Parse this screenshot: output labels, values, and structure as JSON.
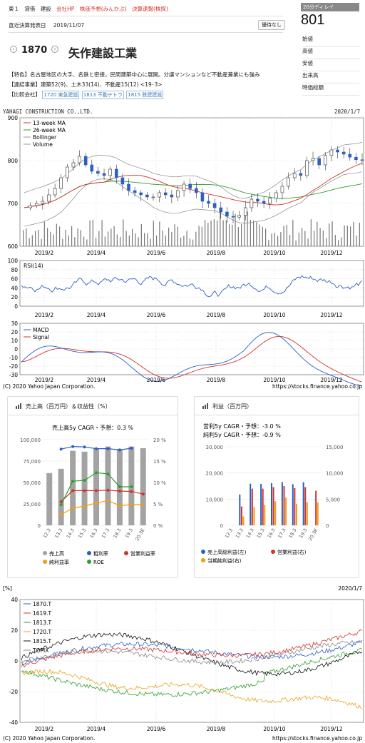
{
  "nav": {
    "market": "東１",
    "margin": "貸借",
    "sector": "建設",
    "company_hp": "会社HP",
    "forecast": "株価予想(みんかぶ)",
    "earnings": "決算速報(株探)"
  },
  "settlement": {
    "label": "直近決算発表日",
    "date": "2019/11/07",
    "button": "優待なし"
  },
  "stock": {
    "code": "1870",
    "name": "矢作建設工業"
  },
  "price": {
    "delay_label": "20分ディレイ",
    "value": "801"
  },
  "stats": [
    "始値",
    "高値",
    "安値",
    "出来高",
    "時価総額"
  ],
  "info": {
    "feature": "【特色】名古屋地区の大手、名鉄と密接。民間建築中心に展開。分譲マンションなど不動産兼業にも強み",
    "business": "【連結事業】建築52(9)、土木33(14)、不動産15(12) <19･3>",
    "compare_label": "【比較会社】",
    "compare": [
      "1720 東急建設",
      "1813 不動テトラ",
      "1815 鉄建建設"
    ]
  },
  "chart_header": {
    "left": "YAHAGI CONSTRUCTION CO.,LTD.",
    "right": "2020/1/7"
  },
  "colors": {
    "accent": "#d2332b",
    "candle_up": "#ffffff",
    "candle_down": "#2a5fc8",
    "link": "#3578b5"
  },
  "price_chart": {
    "type": "line",
    "legend": [
      "13-week MA",
      "26-week MA",
      "Bollinger",
      "Volume"
    ],
    "legend_placement": "top-left",
    "y_ticks": [
      "900",
      "800",
      "700",
      "600"
    ],
    "x_ticks": [
      "2019/2",
      "2019/4",
      "2019/6",
      "2019/8",
      "2019/10",
      "2019/12"
    ],
    "ylim": [
      600,
      900
    ]
  },
  "rsi_chart": {
    "legend": "RSI(14)",
    "y_ticks": [
      "100",
      "80",
      "60",
      "40",
      "20",
      "0"
    ],
    "ylim": [
      0,
      100
    ]
  },
  "macd_chart": {
    "legend": [
      "MACD",
      "Signal"
    ],
    "y_ticks": [
      "30",
      "20",
      "10",
      "0",
      "-10",
      "-20",
      "-30"
    ],
    "ylim": [
      -30,
      30
    ]
  },
  "copyright": {
    "left": "(C) 2020 Yahoo Japan Corporation.",
    "right": "https://stocks.finance.yahoo.co.jp"
  },
  "chart_data": [
    {
      "type": "bar",
      "title": "売上高（百万円）＆収益性（%）",
      "subtitle": "売上高5y CAGR・予想：0.3 %",
      "categories": [
        "12.3",
        "13.3",
        "14.3",
        "15.3",
        "16.3",
        "17.3",
        "18.3",
        "19.3",
        "20.3E"
      ],
      "ylim": [
        0,
        100000
      ],
      "y2lim": [
        0,
        20
      ],
      "y_ticks": [
        "100,000",
        "75,000",
        "50,000",
        "25,000",
        "0"
      ],
      "y2_ticks": [
        "20 %",
        "15 %",
        "10 %",
        "5 %",
        "0 %"
      ],
      "series": [
        {
          "name": "売上高",
          "axis": "left",
          "values": [
            61000,
            66000,
            87000,
            86000,
            90000,
            92000,
            89000,
            92000,
            90000
          ]
        },
        {
          "name": "粗利率",
          "axis": "right",
          "values": [
            null,
            17.8,
            18.4,
            18.3,
            17.9,
            17.9,
            17.6,
            18.0,
            null
          ]
        },
        {
          "name": "営業利益率",
          "axis": "right",
          "values": [
            null,
            5.5,
            8.1,
            8.1,
            8.1,
            8.2,
            8.0,
            7.9,
            7.3
          ]
        },
        {
          "name": "純利益率",
          "axis": "right",
          "values": [
            null,
            2.5,
            4.0,
            4.5,
            5.2,
            5.8,
            4.6,
            4.8,
            4.9
          ]
        },
        {
          "name": "ROE",
          "axis": "right",
          "values": [
            null,
            4.8,
            10.3,
            10.5,
            12.3,
            12.0,
            9.0,
            9.0,
            null
          ]
        }
      ]
    },
    {
      "type": "bar",
      "title": "利益（百万円）",
      "subtitle": [
        "営利5y CAGR・予想：-3.0 %",
        "純利5y CAGR・予想：-0.9 %"
      ],
      "categories": [
        "12.3",
        "13.3",
        "14.3",
        "15.3",
        "16.3",
        "17.3",
        "18.3",
        "19.3",
        "20.3E"
      ],
      "ylim": [
        0,
        30000
      ],
      "y2lim": [
        0,
        15000
      ],
      "y_ticks": [
        "30,000",
        "20,000",
        "10,000",
        "0"
      ],
      "y2_ticks": [
        "15,000",
        "10,000",
        "5,000",
        "0"
      ],
      "series": [
        {
          "name": "売上高総利益(左)",
          "axis": "left",
          "values": [
            null,
            11800,
            15900,
            15800,
            16100,
            16500,
            15700,
            16500,
            null
          ]
        },
        {
          "name": "営業利益(右)",
          "axis": "right",
          "values": [
            null,
            3600,
            7000,
            7000,
            7300,
            7500,
            7100,
            7300,
            6600
          ]
        },
        {
          "name": "当期純利益(右)",
          "axis": "right",
          "values": [
            null,
            1700,
            3500,
            3900,
            4600,
            5300,
            4100,
            4400,
            4400
          ]
        }
      ]
    }
  ],
  "cards": {
    "left_title": "売上高（百万円）＆収益性（%）",
    "left_sub": "売上高5y CAGR・予想：0.3 %",
    "left_legend": [
      "売上高",
      "粗利率",
      "営業利益率",
      "純利益率",
      "ROE"
    ],
    "right_title": "利益（百万円）",
    "right_sub1": "営利5y CAGR・予想：-3.0 %",
    "right_sub2": "純利5y CAGR・予想：-0.9 %",
    "right_legend": [
      "売上高総利益(左)",
      "営業利益(右)",
      "当期純利益(右)"
    ]
  },
  "compare_chart": {
    "unit": "[%]",
    "date": "2020/1/7",
    "legend": [
      "1870.T",
      "1619.T",
      "1813.T",
      "1720.T",
      "1815.T",
      "TOPIX"
    ],
    "colors": [
      "#2a5fc8",
      "#d2332b",
      "#2e9e2e",
      "#e8a21a",
      "#111111",
      "#888888"
    ],
    "y_ticks": [
      "40",
      "20",
      "0",
      "-20",
      "-40"
    ],
    "x_ticks": [
      "2019/2",
      "2019/4",
      "2019/6",
      "2019/8",
      "2019/10",
      "2019/12"
    ]
  }
}
